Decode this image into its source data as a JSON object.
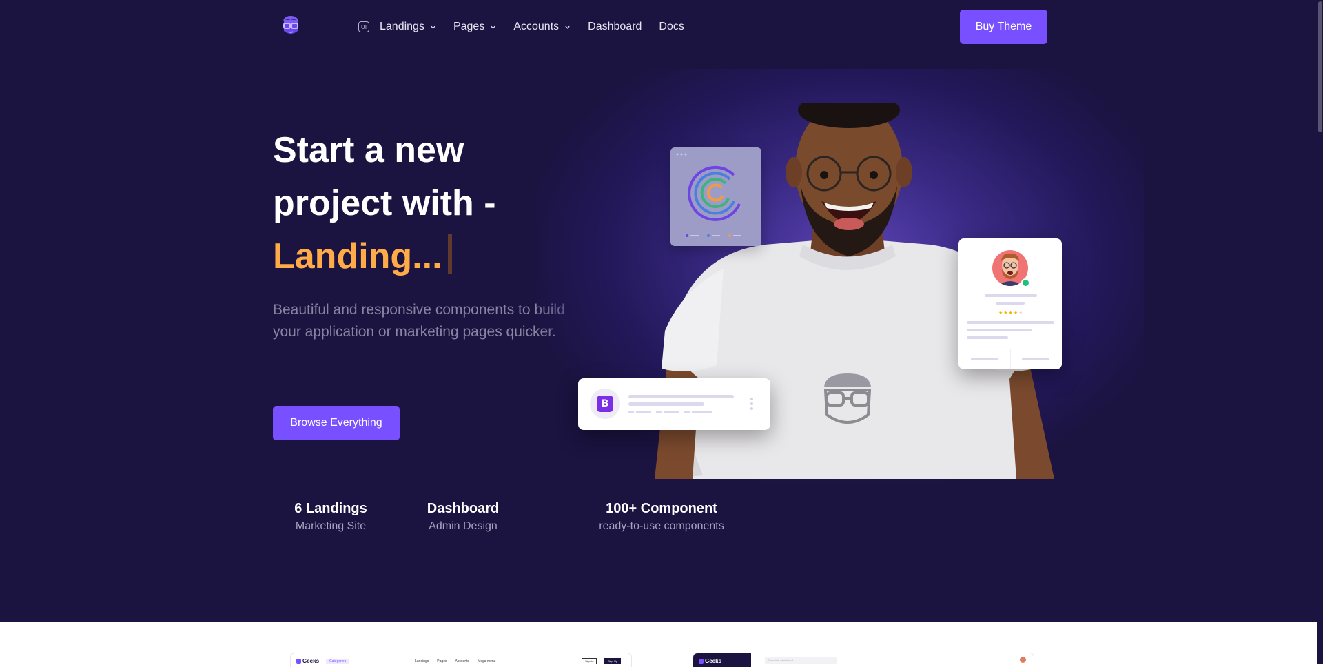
{
  "colors": {
    "hero_bg": "#1b1340",
    "accent": "#7850ff",
    "typed_text": "#ffab47",
    "muted_text": "#8a84a3"
  },
  "nav": {
    "logo": "geeks-logo-icon",
    "badge": "UI",
    "items": [
      {
        "label": "Landings",
        "has_dropdown": true
      },
      {
        "label": "Pages",
        "has_dropdown": true
      },
      {
        "label": "Accounts",
        "has_dropdown": true
      },
      {
        "label": "Dashboard",
        "has_dropdown": false
      },
      {
        "label": "Docs",
        "has_dropdown": false
      }
    ],
    "cta": "Buy Theme"
  },
  "hero": {
    "headline_line1": "Start a new",
    "headline_line2": "project with -",
    "typed": "Landing...",
    "subtext": "Beautiful and responsive components to build your application or marketing pages quicker.",
    "button": "Browse Everything",
    "bootstrap_badge": "B"
  },
  "stats": [
    {
      "title": "6 Landings",
      "subtitle": "Marketing Site"
    },
    {
      "title": "Dashboard",
      "subtitle": "Admin Design"
    },
    {
      "title": "100+ Component",
      "subtitle": "ready-to-use components"
    }
  ],
  "previews": {
    "left": {
      "brand": "Geeks",
      "chip": "Categories",
      "menu": [
        "Landings",
        "Pages",
        "Accounts",
        "Mega menu"
      ],
      "sign_in": "Sign In",
      "sign_up": "Sign Up"
    },
    "right": {
      "brand": "Geeks",
      "search_placeholder": "Search in dashboard"
    }
  }
}
